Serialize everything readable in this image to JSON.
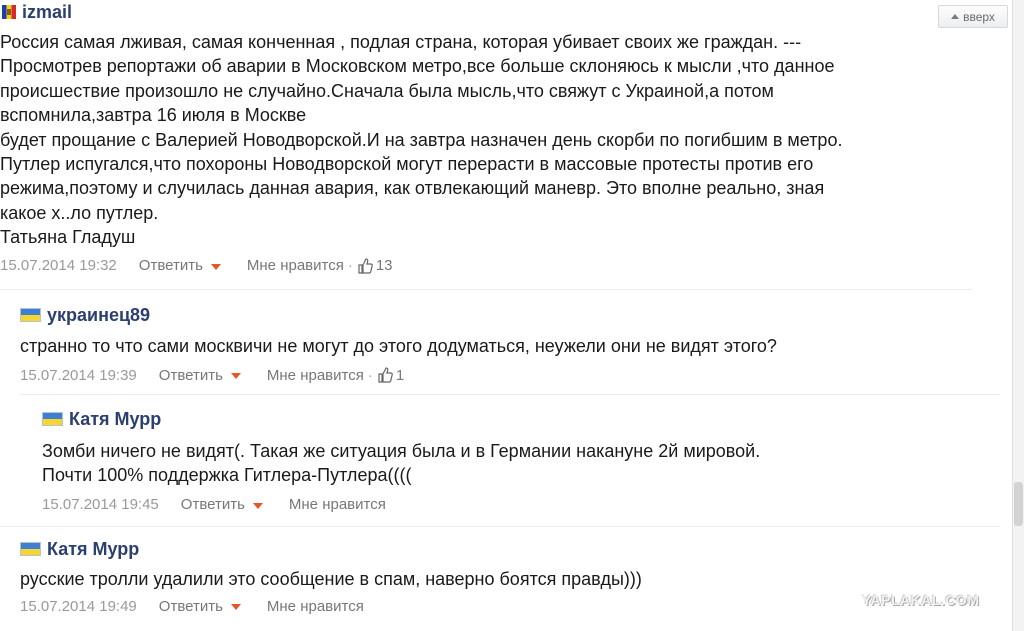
{
  "top_button": {
    "label": "вверх"
  },
  "comments": [
    {
      "author": "izmail",
      "text": "Россия самая лживая, самая конченная , подлая страна, которая убивает своих же граждан. ---\nПросмотрев репортажи об аварии в Московском метро,все больше склоняюсь к мысли ,что данное\nпроисшествие произошло не случайно.Сначала была мысль,что свяжут с Украиной,а потом\nвспомнила,завтра 16 июля в Москве\nбудет прощание с Валерией Новодворской.И на завтра назначен день скорби по погибшим в метро.\nПутлер испугался,что похороны Новодворской могут перерасти в массовые протесты против его\nрежима,поэтому и случилась данная авария, как отвлекающий маневр. Это вполне реально, зная\nкакое х..ло путлер.\nТатьяна Гладуш",
      "date": "15.07.2014 19:32",
      "reply": "Ответить",
      "like": "Мне нравится",
      "likes": "13"
    },
    {
      "author": "украинец89",
      "text": "странно то что сами москвичи не могут до этого додуматься, неужели они не видят этого?",
      "date": "15.07.2014 19:39",
      "reply": "Ответить",
      "like": "Мне нравится",
      "likes": "1"
    },
    {
      "author": "Катя Мурр",
      "text": "Зомби ничего не видят(. Такая же ситуация была и в Германии накануне 2й мировой.\nПочти 100% поддержка Гитлера-Путлера((((",
      "date": "15.07.2014 19:45",
      "reply": "Ответить",
      "like": "Мне нравится"
    },
    {
      "author": "Катя Мурр",
      "text": "русские тролли удалили это сообщение в спам, наверно боятся правды)))",
      "date": "15.07.2014 19:49",
      "reply": "Ответить",
      "like": "Мне нравится"
    }
  ],
  "watermark": "YAPLAKAL.COM"
}
